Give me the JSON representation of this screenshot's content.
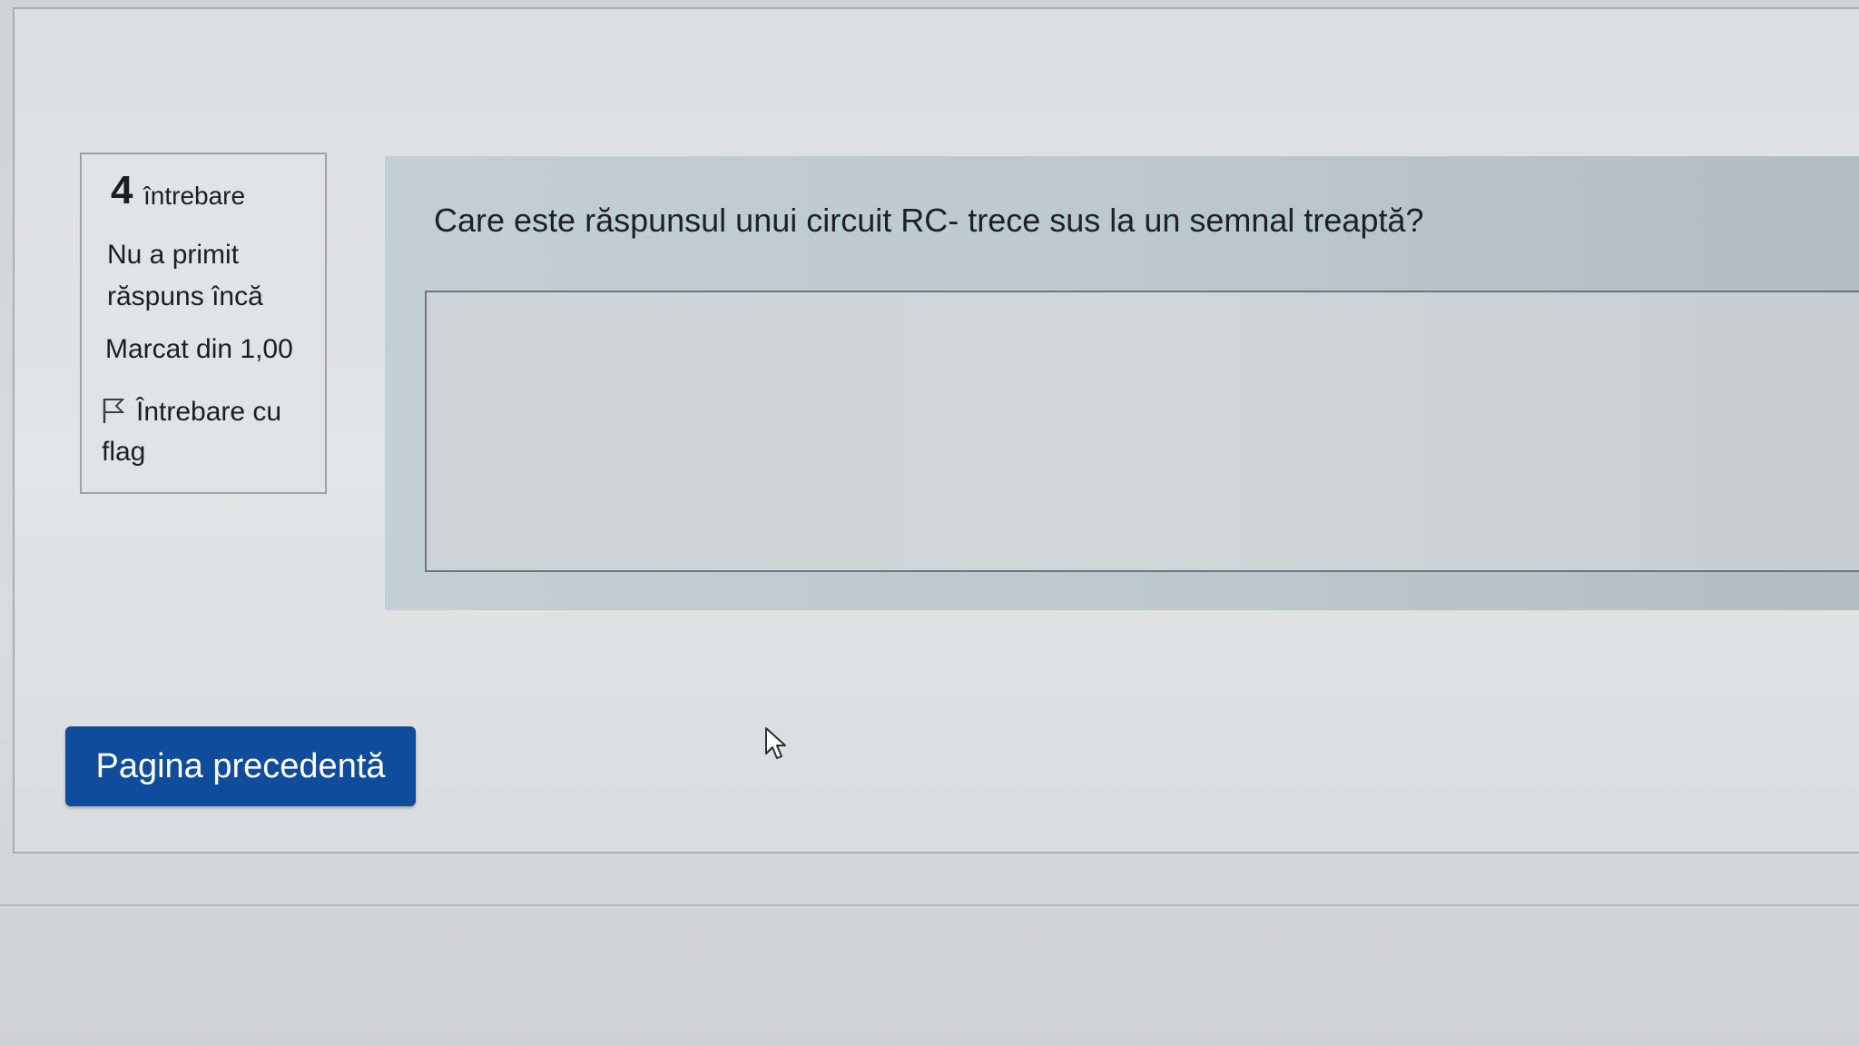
{
  "question_info": {
    "number": "4",
    "label": "întrebare",
    "state": "Nu a primit răspuns încă",
    "grade": "Marcat din 1,00",
    "flag_label": "Întrebare cu flag"
  },
  "question": {
    "text": "Care este răspunsul unui circuit RC- trece sus la un semnal treaptă?",
    "answer_value": ""
  },
  "navigation": {
    "prev_label": "Pagina precedentă"
  },
  "icons": {
    "flag": "flag-icon",
    "cursor": "mouse-pointer-icon"
  },
  "colors": {
    "button": "#0f4c9c",
    "question_panel": "#bcc9cf"
  }
}
